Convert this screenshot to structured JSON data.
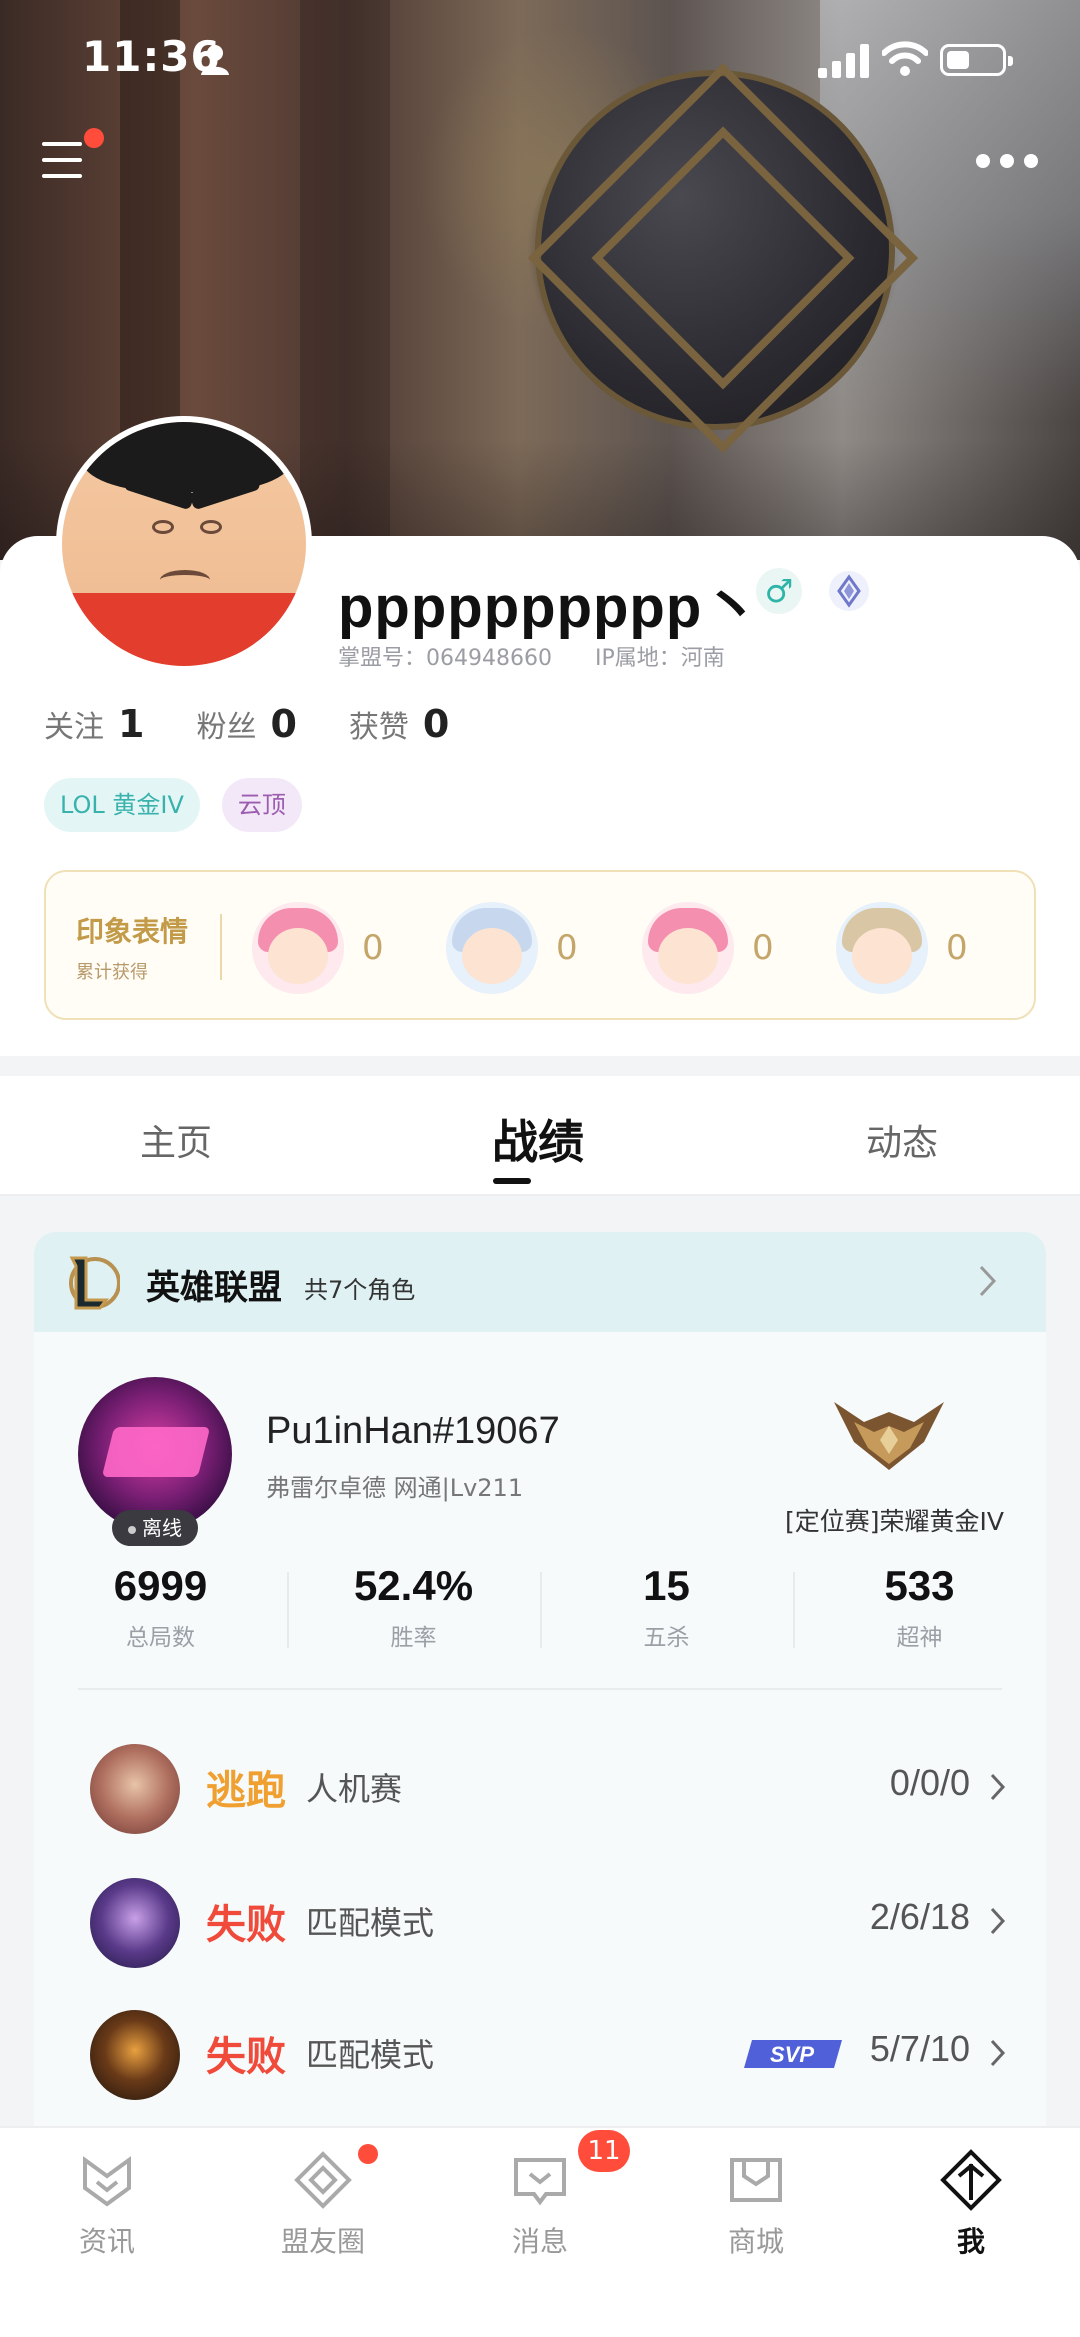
{
  "status_bar": {
    "time": "11:36"
  },
  "profile": {
    "username": "pppppppppp丶",
    "gender_symbol": "♂",
    "account_id": "掌盟号：064948660",
    "ip_location": "IP属地：河南",
    "stats": [
      {
        "label": "关注",
        "value": "1"
      },
      {
        "label": "粉丝",
        "value": "0"
      },
      {
        "label": "获赞",
        "value": "0"
      }
    ],
    "tags": [
      "LOL 黄金IV",
      "云顶"
    ]
  },
  "impression": {
    "title": "印象表情",
    "subtitle": "累计获得",
    "items": [
      {
        "icon": "emoji-pink-hair-icon",
        "count": "0"
      },
      {
        "icon": "emoji-blue-hair-wave-icon",
        "count": "0"
      },
      {
        "icon": "emoji-pink-hair-heart-icon",
        "count": "0"
      },
      {
        "icon": "emoji-gg-icon",
        "count": "0"
      }
    ]
  },
  "tabs": [
    {
      "label": "主页",
      "active": false
    },
    {
      "label": "战绩",
      "active": true
    },
    {
      "label": "动态",
      "active": false
    }
  ],
  "game": {
    "name": "英雄联盟",
    "role_count": "共7个角色",
    "player": {
      "name": "Pu1inHan#19067",
      "server": "弗雷尔卓德 网通|Lv211",
      "status": "离线",
      "rank": "[定位赛]荣耀黄金IV"
    },
    "stats": [
      {
        "value": "6999",
        "label": "总局数"
      },
      {
        "value": "52.4%",
        "label": "胜率"
      },
      {
        "value": "15",
        "label": "五杀"
      },
      {
        "value": "533",
        "label": "超神"
      }
    ],
    "matches": [
      {
        "result": "逃跑",
        "result_color": "#f0a030",
        "mode": "人机赛",
        "kda": "0/0/0",
        "svp": false
      },
      {
        "result": "失败",
        "result_color": "#f04a3a",
        "mode": "匹配模式",
        "kda": "2/6/18",
        "svp": false
      },
      {
        "result": "失败",
        "result_color": "#f04a3a",
        "mode": "匹配模式",
        "kda": "5/7/10",
        "svp": true
      }
    ]
  },
  "bottom_nav": {
    "items": [
      {
        "label": "资讯",
        "icon": "news-icon"
      },
      {
        "label": "盟友圈",
        "icon": "community-icon"
      },
      {
        "label": "消息",
        "icon": "message-icon"
      },
      {
        "label": "商城",
        "icon": "shop-icon"
      },
      {
        "label": "我",
        "icon": "me-icon"
      }
    ],
    "message_badge": "11"
  },
  "colors": {
    "accent_red": "#ff4c3b",
    "lose": "#f04a3a",
    "escape": "#f0a030",
    "teal": "#38b2ac"
  }
}
